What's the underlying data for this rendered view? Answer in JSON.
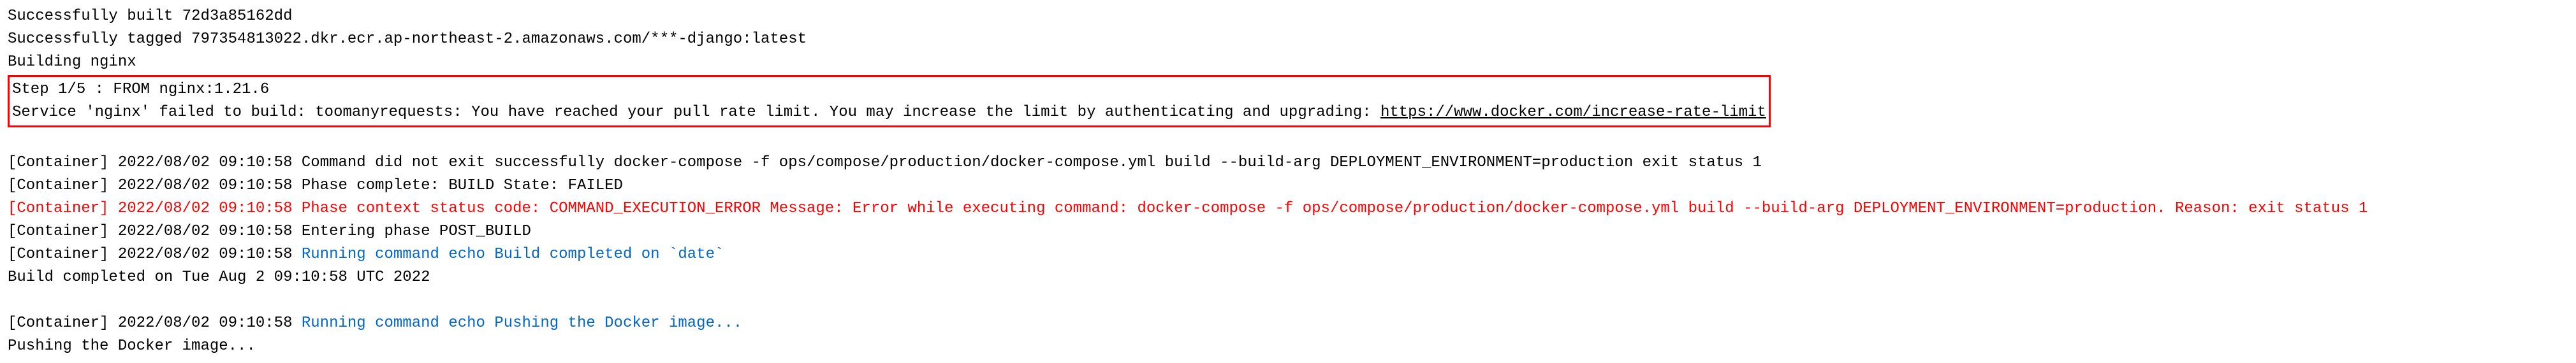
{
  "log": {
    "line1": "Successfully built 72d3a85162dd",
    "line2": "Successfully tagged 797354813022.dkr.ecr.ap-northeast-2.amazonaws.com/***-django:latest",
    "line3": "Building nginx",
    "box_line1": "Step 1/5 : FROM        nginx:1.21.6",
    "box_line2_prefix": "Service 'nginx' failed to build: toomanyrequests: You have reached your pull rate limit. You may increase the limit by authenticating and upgrading: ",
    "box_line2_link": "https://www.docker.com/increase-rate-limit",
    "line6_prefix": "[Container] 2022/08/02 09:10:58 ",
    "line6_rest": "Command did not exit successfully docker-compose -f ops/compose/production/docker-compose.yml build --build-arg DEPLOYMENT_ENVIRONMENT=production exit status 1",
    "line7_prefix": "[Container] 2022/08/02 09:10:58 ",
    "line7_rest": "Phase complete: BUILD State: FAILED",
    "line8_prefix": "[Container] 2022/08/02 09:10:58 ",
    "line8_rest": "Phase context status code: COMMAND_EXECUTION_ERROR Message: Error while executing command: docker-compose -f ops/compose/production/docker-compose.yml build --build-arg DEPLOYMENT_ENVIRONMENT=production. Reason: exit status 1",
    "line9_prefix": "[Container] 2022/08/02 09:10:58 ",
    "line9_rest": "Entering phase POST_BUILD",
    "line10_prefix": "[Container] 2022/08/02 09:10:58 ",
    "line10_cmd": "Running command echo Build completed on `date`",
    "line11": "Build completed on Tue Aug 2 09:10:58 UTC 2022",
    "line12_prefix": "[Container] 2022/08/02 09:10:58 ",
    "line12_cmd": "Running command echo Pushing the Docker image...",
    "line13": "Pushing the Docker image..."
  }
}
